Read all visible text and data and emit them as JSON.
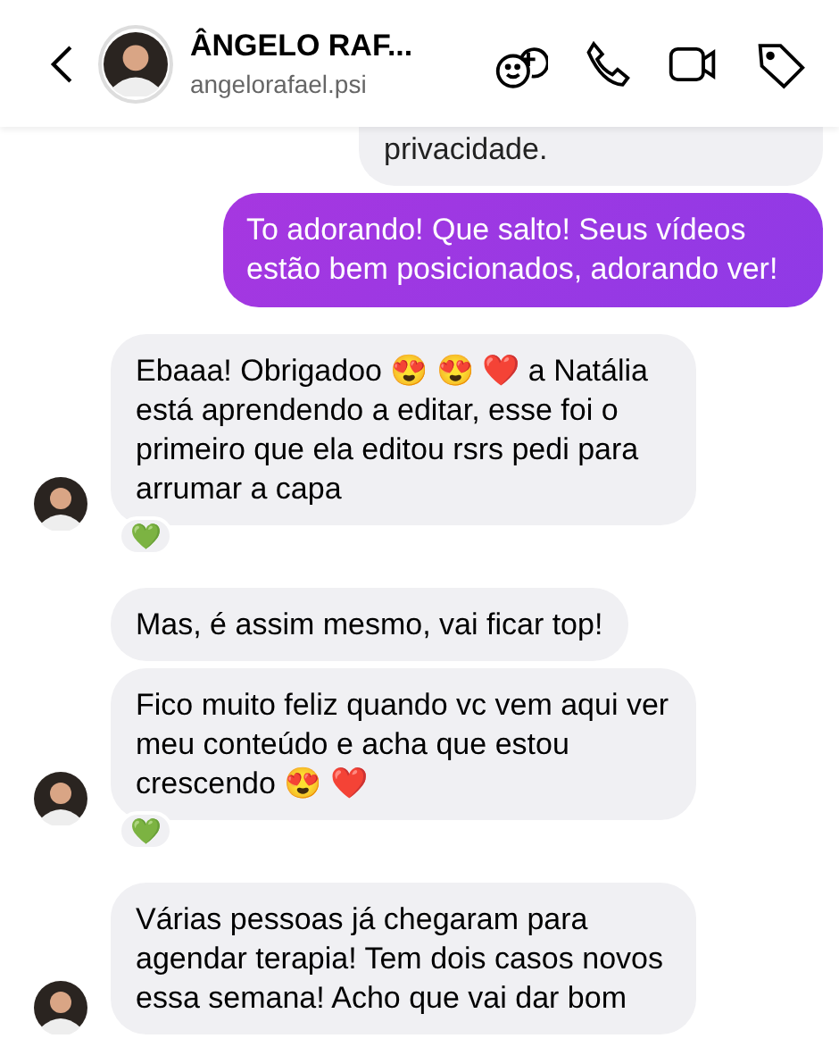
{
  "header": {
    "title": "ÂNGELO RAF...",
    "subtitle": "angelorafael.psi"
  },
  "messages": [
    {
      "kind": "quote",
      "text": "privacidade."
    },
    {
      "kind": "outgoing",
      "text": "To adorando! Que salto! Seus vídeos estão bem posicionados, adorando ver!"
    },
    {
      "kind": "incoming",
      "text": "Ebaaa! Obrigadoo 😍 😍 ❤️ a Natália está aprendendo a editar, esse foi o primeiro que ela editou rsrs pedi para arrumar a capa",
      "avatar": true,
      "reaction": "💚"
    },
    {
      "kind": "incoming",
      "text": "Mas, é assim mesmo, vai ficar top!",
      "avatar": false
    },
    {
      "kind": "incoming",
      "text": "Fico muito feliz quando vc vem aqui ver meu conteúdo e acha que estou crescendo 😍 ❤️",
      "avatar": true,
      "reaction": "💚"
    },
    {
      "kind": "incoming",
      "text": "Várias pessoas já chegaram para agendar terapia! Tem dois casos novos essa semana! Acho que vai dar bom",
      "avatar": true
    }
  ]
}
